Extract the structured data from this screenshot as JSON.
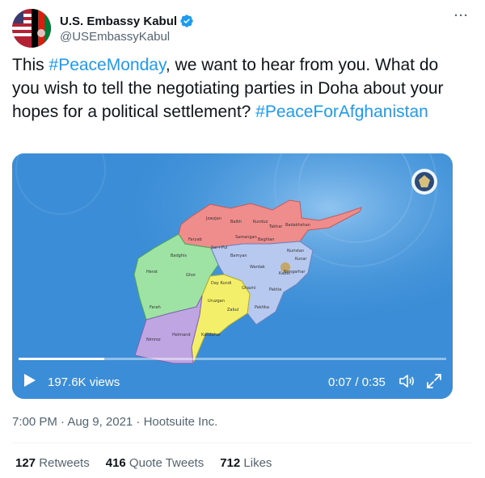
{
  "tweet": {
    "author": {
      "display_name": "U.S. Embassy Kabul",
      "handle": "@USEmbassyKabul",
      "verified": true
    },
    "more_icon": "more-horizontal-icon",
    "text_parts": [
      "This ",
      "#PeaceMonday",
      ", we want to hear from you. What do you wish to tell the negotiating parties in Doha about your hopes for a political settlement? ",
      "#PeaceForAfghanistan"
    ],
    "media": {
      "type": "video",
      "views": "197.6K views",
      "time": "0:07 / 0:35",
      "progress": 0.2,
      "map_labels": {
        "jowzjan": "Jowzjan",
        "balkh": "Balkh",
        "samangan": "Samangan",
        "kunduz": "Kunduz",
        "takhar": "Takhar",
        "badakhshan": "Badakhshan",
        "faryab": "Faryab",
        "sar_e_pul": "Sar-i-Pul",
        "baghlan": "Baghlan",
        "badghis": "Badghis",
        "herat": "Herat",
        "ghor": "Ghor",
        "bamyan": "Bamyan",
        "nuristan": "Nuristan",
        "kunar": "Kunar",
        "wardak": "Wardak",
        "kabul": "Kabul",
        "nangarhar": "Nangarhar",
        "day_kundi": "Day Kundi",
        "ghazni": "Ghazni",
        "paktia": "Paktia",
        "uruzgan": "Uruzgan",
        "zabul": "Zabul",
        "paktika": "Paktika",
        "farah": "Farah",
        "nimroz": "Nimroz",
        "helmand": "Helmand",
        "kandahar": "Kandahar"
      }
    },
    "timestamp": "7:00 PM · Aug 9, 2021 · Hootsuite Inc.",
    "stats": {
      "retweets_num": "127",
      "retweets_label": " Retweets",
      "quotes_num": "416",
      "quotes_label": " Quote Tweets",
      "likes_num": "712",
      "likes_label": " Likes"
    },
    "colors": {
      "link": "#1d9bf0",
      "secondary": "#536471",
      "video_bg": "#3c8fd8",
      "region_north": "#ef8c8c",
      "region_west": "#9ee3a4",
      "region_east": "#b7c9ef",
      "region_center": "#f3ef6b",
      "region_south": "#bfa5e2"
    }
  }
}
